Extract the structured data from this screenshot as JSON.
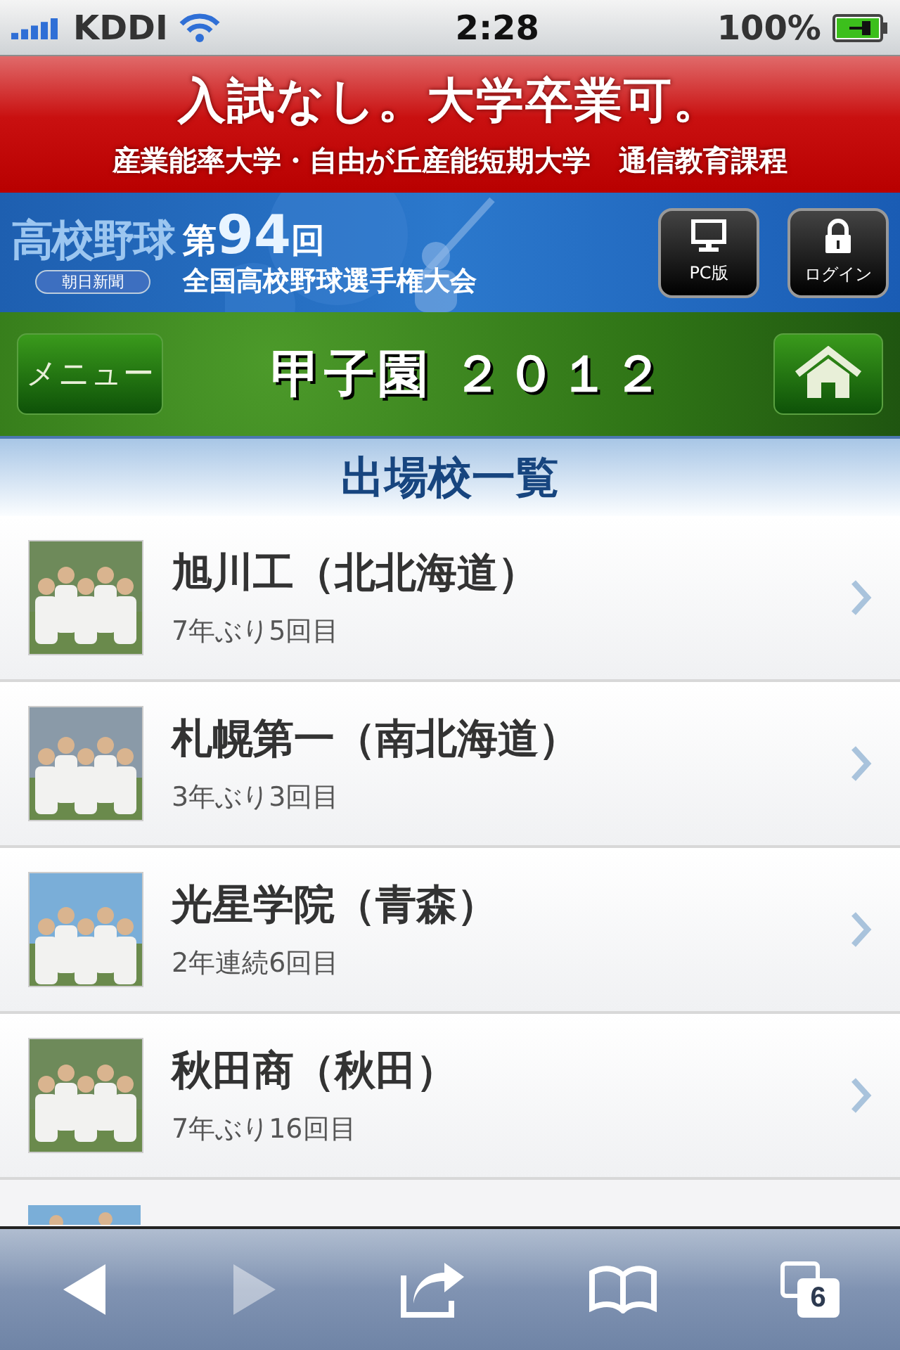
{
  "status_bar": {
    "carrier": "KDDI",
    "time": "2:28",
    "battery": "100%"
  },
  "ad_banner": {
    "headline": "入試なし。大学卒業可。",
    "subline": "産業能率大学・自由が丘産能短期大学　通信教育課程"
  },
  "header": {
    "logo": "高校野球",
    "logo_sub": "朝日新聞",
    "edition_prefix": "第",
    "edition_number": "94",
    "edition_suffix": "回",
    "tournament": "全国高校野球選手権大会",
    "buttons": [
      {
        "kind": "pc",
        "label": "PC版"
      },
      {
        "kind": "login",
        "label": "ログイン"
      }
    ]
  },
  "nav": {
    "menu": "メニュー",
    "title": "甲子園 ２０１２"
  },
  "section_title": "出場校一覧",
  "schools": [
    {
      "name": "旭川工（北北海道）",
      "detail": "7年ぶり5回目"
    },
    {
      "name": "札幌第一（南北海道）",
      "detail": "3年ぶり3回目"
    },
    {
      "name": "光星学院（青森）",
      "detail": "2年連続6回目"
    },
    {
      "name": "秋田商（秋田）",
      "detail": "7年ぶり16回目"
    }
  ],
  "toolbar": {
    "buttons": [
      {
        "kind": "back",
        "disabled": false
      },
      {
        "kind": "forward",
        "disabled": true
      },
      {
        "kind": "share",
        "disabled": false
      },
      {
        "kind": "bookmarks",
        "disabled": false
      },
      {
        "kind": "tabs",
        "disabled": false,
        "count": "6"
      }
    ]
  }
}
